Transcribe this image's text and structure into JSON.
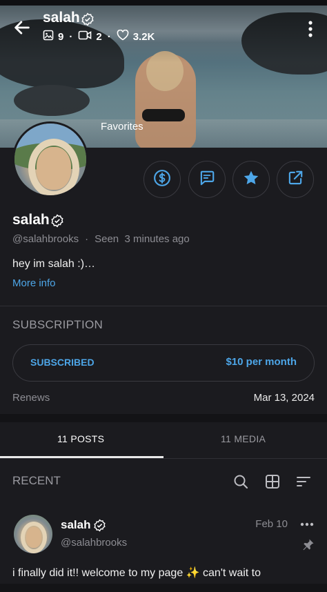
{
  "header": {
    "name": "salah",
    "stats": {
      "photos": "9",
      "videos": "2",
      "likes": "3.2K"
    },
    "cover_caption": "Favorites"
  },
  "profile": {
    "name": "salah",
    "handle": "@salahbrooks",
    "seen_label": "Seen",
    "seen_time": "3 minutes ago",
    "bio": "hey im salah :)…",
    "more_info": "More info"
  },
  "actions": {
    "tip_icon": "dollar-circle-icon",
    "message_icon": "message-icon",
    "favorite_icon": "star-icon",
    "share_icon": "share-icon"
  },
  "subscription": {
    "heading": "SUBSCRIPTION",
    "status": "SUBSCRIBED",
    "price": "$10 per month",
    "renews_label": "Renews",
    "renews_date": "Mar 13, 2024"
  },
  "tabs": [
    {
      "label": "11 POSTS",
      "active": true
    },
    {
      "label": "11 MEDIA",
      "active": false
    }
  ],
  "feed": {
    "heading": "RECENT",
    "post": {
      "author": "salah",
      "handle": "@salahbrooks",
      "date": "Feb 10",
      "text": "i finally did it!! welcome to my page ✨ can't wait to"
    }
  },
  "colors": {
    "accent": "#4da6e8",
    "background": "#1b1b1f"
  }
}
